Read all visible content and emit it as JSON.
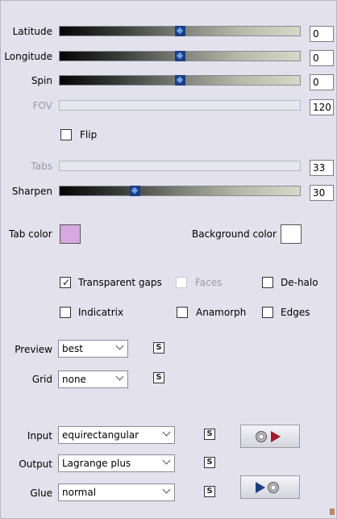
{
  "sliders": {
    "latitude": {
      "label": "Latitude",
      "value": "0",
      "position": 0.5
    },
    "longitude": {
      "label": "Longitude",
      "value": "0",
      "position": 0.5
    },
    "spin": {
      "label": "Spin",
      "value": "0",
      "position": 0.5
    },
    "fov": {
      "label": "FOV",
      "value": "120",
      "enabled": false
    },
    "tabs": {
      "label": "Tabs",
      "value": "33",
      "enabled": false
    },
    "sharpen": {
      "label": "Sharpen",
      "value": "30",
      "position": 0.3
    }
  },
  "flip": {
    "label": "Flip",
    "checked": false
  },
  "tab_color": {
    "label": "Tab color",
    "color": "#d8a8e0"
  },
  "background_color": {
    "label": "Background color",
    "color": "#ffffff"
  },
  "options": {
    "transparent_gaps": {
      "label": "Transparent gaps",
      "checked": true
    },
    "faces": {
      "label": "Faces",
      "checked": false,
      "enabled": false
    },
    "de_halo": {
      "label": "De-halo",
      "checked": false
    },
    "indicatrix": {
      "label": "Indicatrix",
      "checked": false
    },
    "anamorph": {
      "label": "Anamorph",
      "checked": false
    },
    "edges": {
      "label": "Edges",
      "checked": false
    }
  },
  "preview": {
    "label": "Preview",
    "value": "best"
  },
  "grid": {
    "label": "Grid",
    "value": "none"
  },
  "input": {
    "label": "Input",
    "value": "equirectangular"
  },
  "output": {
    "label": "Output",
    "value": "Lagrange plus"
  },
  "glue": {
    "label": "Glue",
    "value": "normal"
  },
  "s_button_label": "S",
  "colors": {
    "accent_red": "#a8182a",
    "accent_blue": "#1b3f85"
  }
}
